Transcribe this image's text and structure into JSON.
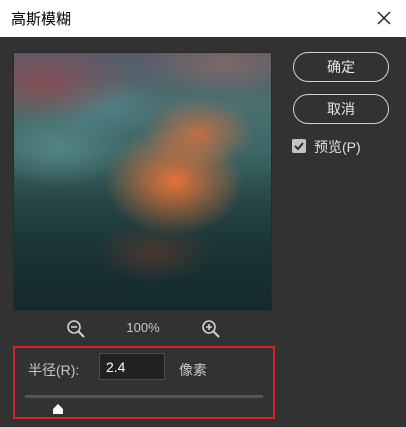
{
  "dialog": {
    "title": "高斯模糊",
    "ok_label": "确定",
    "cancel_label": "取消",
    "preview_label": "预览(P)",
    "preview_checked": true
  },
  "zoom": {
    "level": "100%"
  },
  "radius": {
    "label": "半径(R):",
    "value": "2.4",
    "unit": "像素",
    "slider_fraction": 0.14
  },
  "colors": {
    "background": "#323232",
    "highlight_border": "#d5232a",
    "preview_orange": "#ec7436",
    "preview_teal": "#264545"
  },
  "icons": {
    "close": "close-icon",
    "zoom_out": "zoom-out-icon",
    "zoom_in": "zoom-in-icon",
    "checkbox": "checkmark-icon",
    "slider": "slider-thumb-icon"
  }
}
